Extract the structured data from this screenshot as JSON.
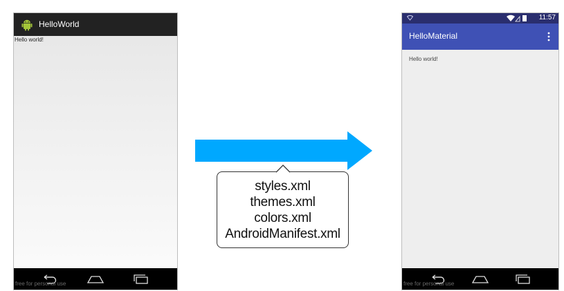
{
  "left_phone": {
    "app_title": "HelloWorld",
    "content_text": "Hello world!",
    "watermark": "free for personal use",
    "icons": [
      "android-logo-icon",
      "back-icon",
      "home-icon",
      "recents-icon"
    ]
  },
  "transition": {
    "arrow_color": "#00a8ff",
    "files": [
      "styles.xml",
      "themes.xml",
      "colors.xml",
      "AndroidManifest.xml"
    ]
  },
  "right_phone": {
    "status_time": "11:57",
    "app_title": "HelloMaterial",
    "content_text": "Hello world!",
    "watermark": "free for personal use",
    "toolbar_color": "#3f51b5",
    "status_bar_color": "#2a2e6e",
    "icons": [
      "signal-icon",
      "wifi-icon",
      "battery-icon",
      "overflow-menu-icon",
      "back-icon",
      "home-icon",
      "recents-icon"
    ]
  }
}
